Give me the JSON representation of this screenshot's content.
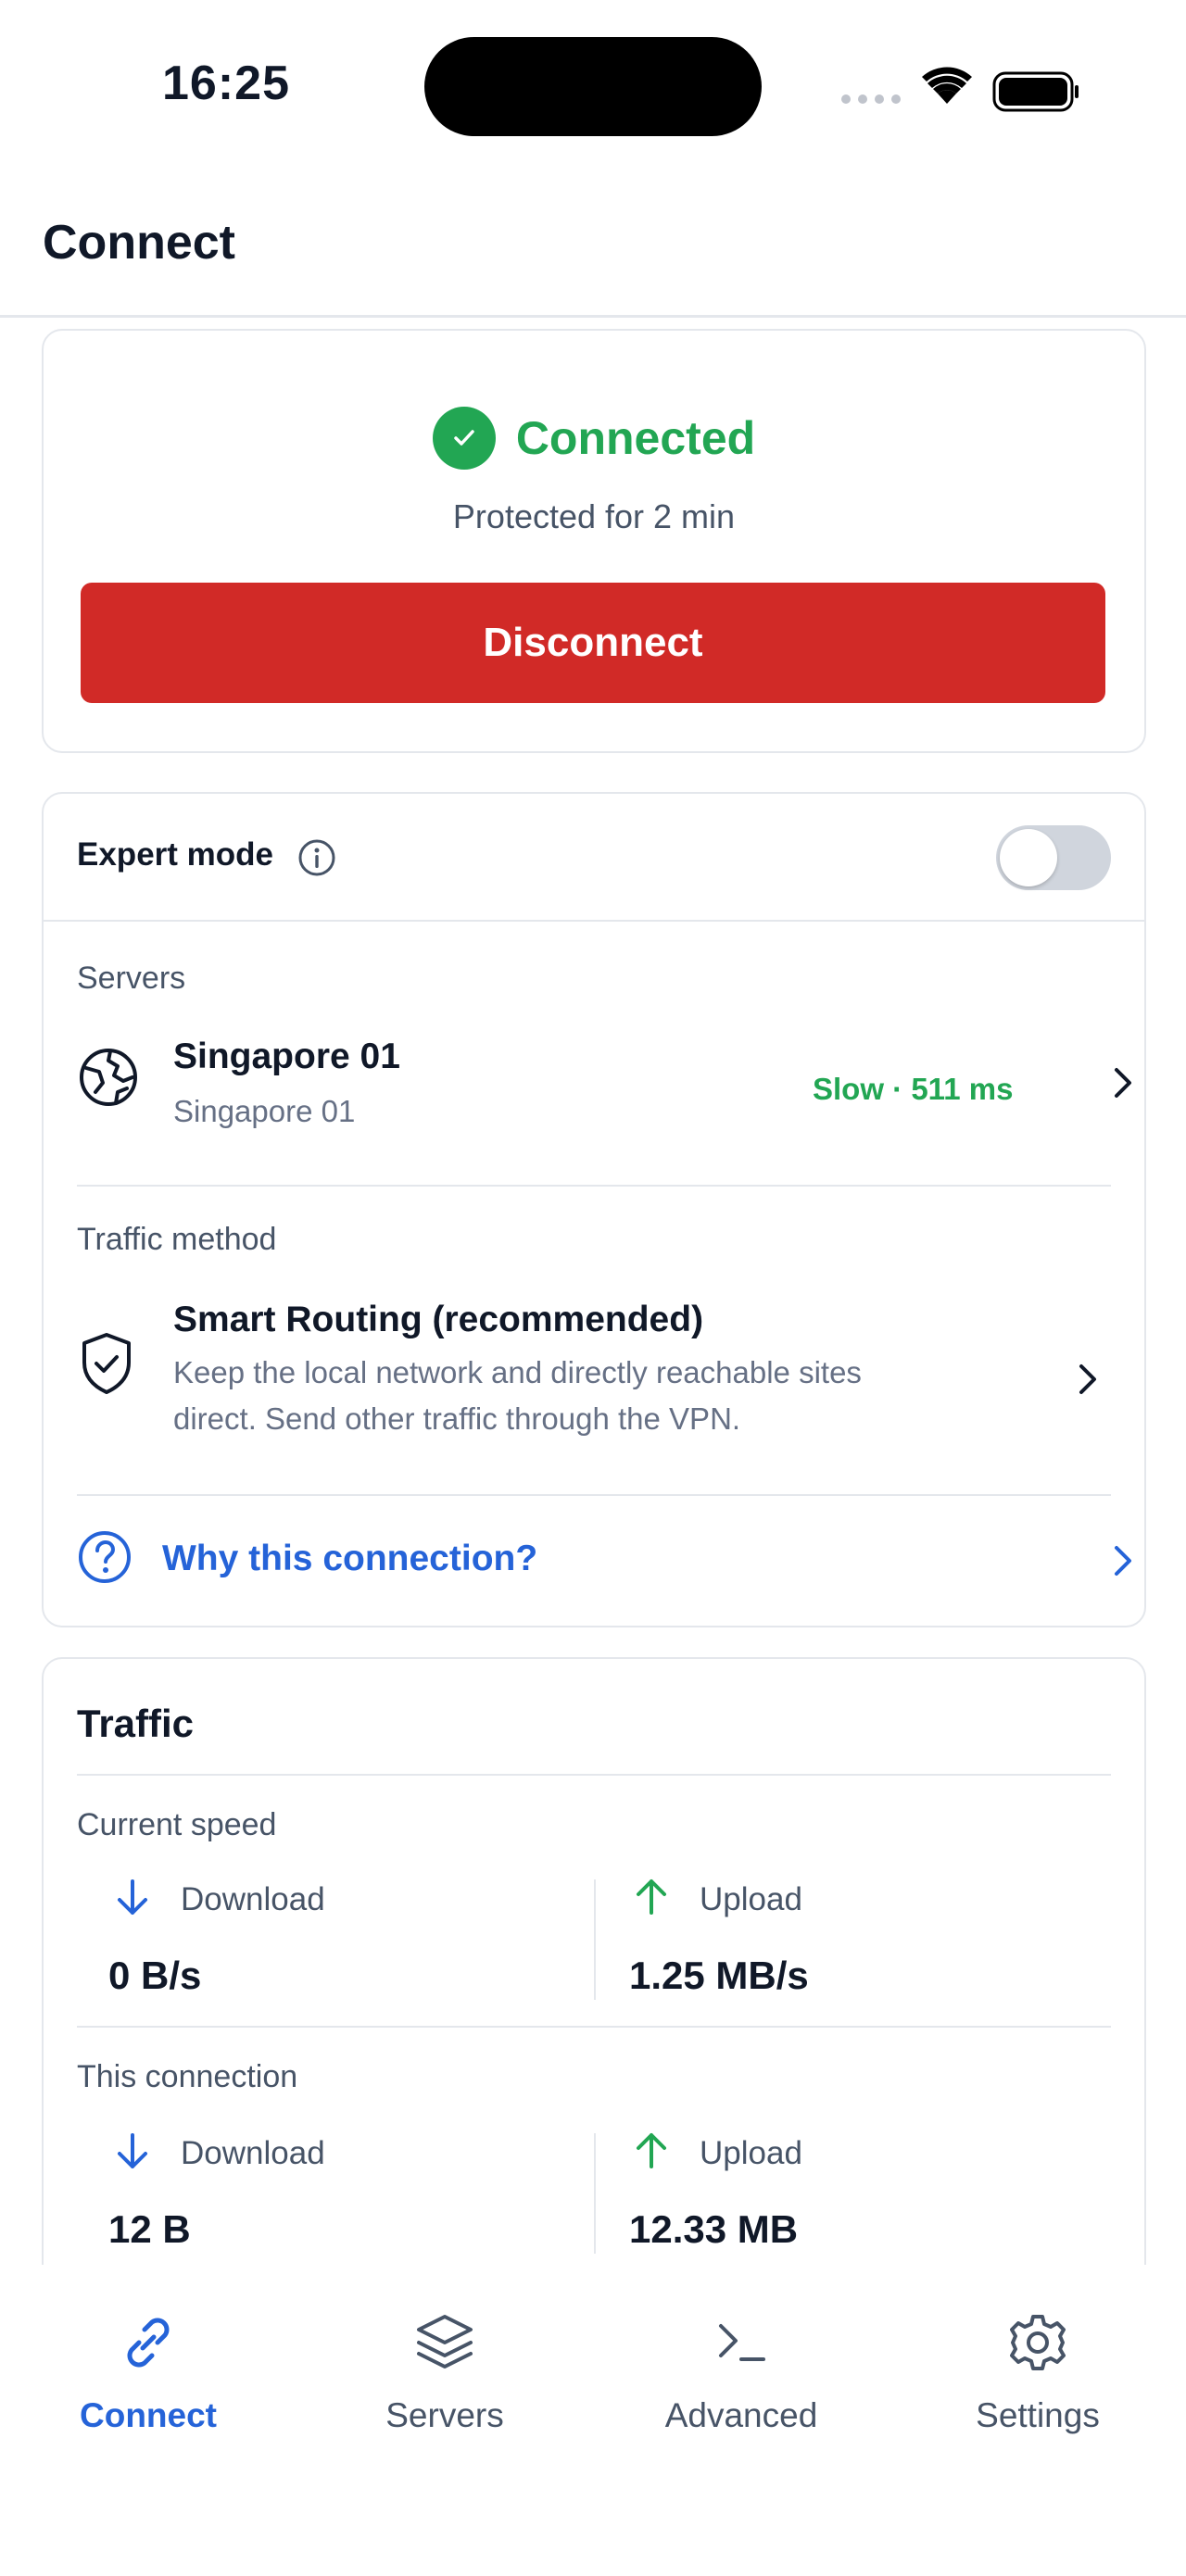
{
  "status_bar": {
    "time": "16:25"
  },
  "header": {
    "title": "Connect"
  },
  "connection": {
    "status": "Connected",
    "protected_text": "Protected for 2 min",
    "disconnect_label": "Disconnect"
  },
  "expert": {
    "label": "Expert mode",
    "toggle_on": false,
    "servers_label": "Servers",
    "server_name": "Singapore 01",
    "server_sub": "Singapore 01",
    "server_latency": "Slow · 511 ms",
    "traffic_method_label": "Traffic method",
    "method_title": "Smart Routing (recommended)",
    "method_desc_line1": "Keep the local network and directly reachable sites",
    "method_desc_line2": "direct. Send other traffic through the VPN.",
    "why_link": "Why this connection?"
  },
  "traffic": {
    "title": "Traffic",
    "current_speed_label": "Current speed",
    "current": {
      "download_label": "Download",
      "download_value": "0 B/s",
      "upload_label": "Upload",
      "upload_value": "1.25 MB/s"
    },
    "this_connection_label": "This connection",
    "connection": {
      "download_label": "Download",
      "download_value": "12 B",
      "upload_label": "Upload",
      "upload_value": "12.33 MB"
    }
  },
  "tabs": [
    {
      "label": "Connect",
      "icon": "link-icon",
      "active": true
    },
    {
      "label": "Servers",
      "icon": "layers-icon",
      "active": false
    },
    {
      "label": "Advanced",
      "icon": "terminal-icon",
      "active": false
    },
    {
      "label": "Settings",
      "icon": "gear-icon",
      "active": false
    }
  ],
  "colors": {
    "accent": "#2563d8",
    "success": "#22a653",
    "danger": "#d12a27"
  }
}
